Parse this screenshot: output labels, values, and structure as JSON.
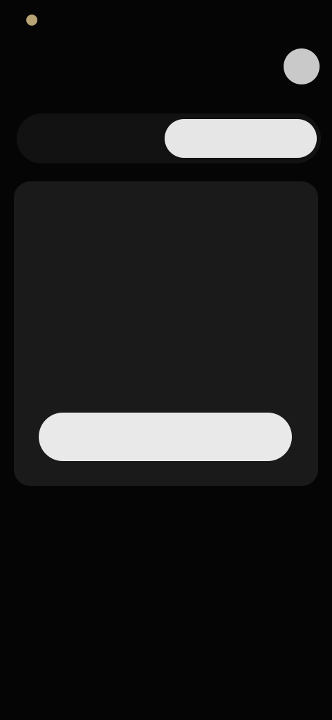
{
  "status_bar": {
    "left_text": "",
    "right_text": ""
  },
  "header": {
    "title": "",
    "subtitle": ""
  },
  "segmented": {
    "options": [
      "",
      ""
    ],
    "selected": 1
  },
  "card": {
    "title": "",
    "link": "",
    "description": "",
    "section_label": "",
    "features": [
      "",
      "",
      "",
      ""
    ],
    "cta_label": ""
  },
  "footer": {
    "note": "",
    "legal_left": "",
    "legal_right": "",
    "legal_sub": ""
  },
  "colors": {
    "background": "#050505",
    "card": "#1a1a1a",
    "accent_dot": "#b9a476",
    "button": "#e9e9e9"
  }
}
